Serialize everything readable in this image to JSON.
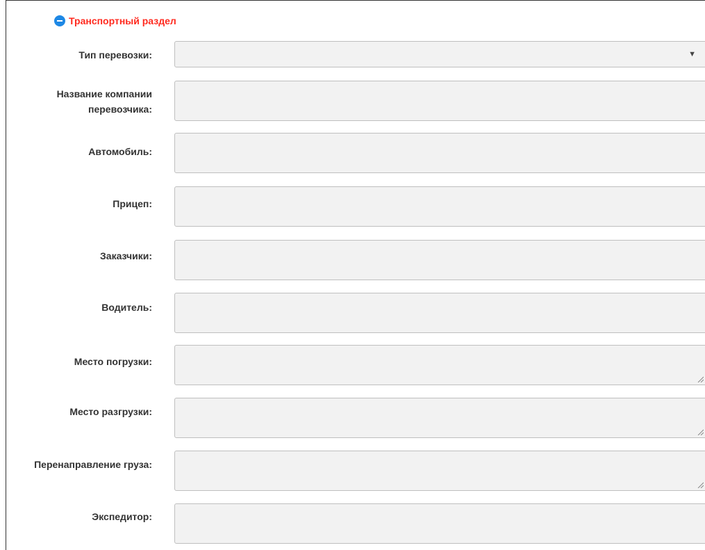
{
  "section": {
    "title": "Транспортный раздел",
    "toggle_icon": "collapse-circle-minus-icon",
    "title_color": "#ff2a1f",
    "icon_color": "#1e88e5"
  },
  "fields": {
    "transport_type": {
      "label": "Тип перевозки:",
      "value": ""
    },
    "carrier_company": {
      "label_line1": "Название компании",
      "label_line2": "перевозчика:",
      "value": ""
    },
    "vehicle": {
      "label": "Автомобиль:",
      "value": ""
    },
    "trailer": {
      "label": "Прицеп:",
      "value": ""
    },
    "customers": {
      "label": "Заказчики:",
      "value": ""
    },
    "driver": {
      "label": "Водитель:",
      "value": ""
    },
    "loading_place": {
      "label": "Место погрузки:",
      "value": ""
    },
    "unloading_place": {
      "label": "Место разгрузки:",
      "value": ""
    },
    "cargo_redirect": {
      "label": "Перенаправление груза:",
      "value": ""
    },
    "forwarder": {
      "label": "Экспедитор:",
      "value": ""
    }
  }
}
